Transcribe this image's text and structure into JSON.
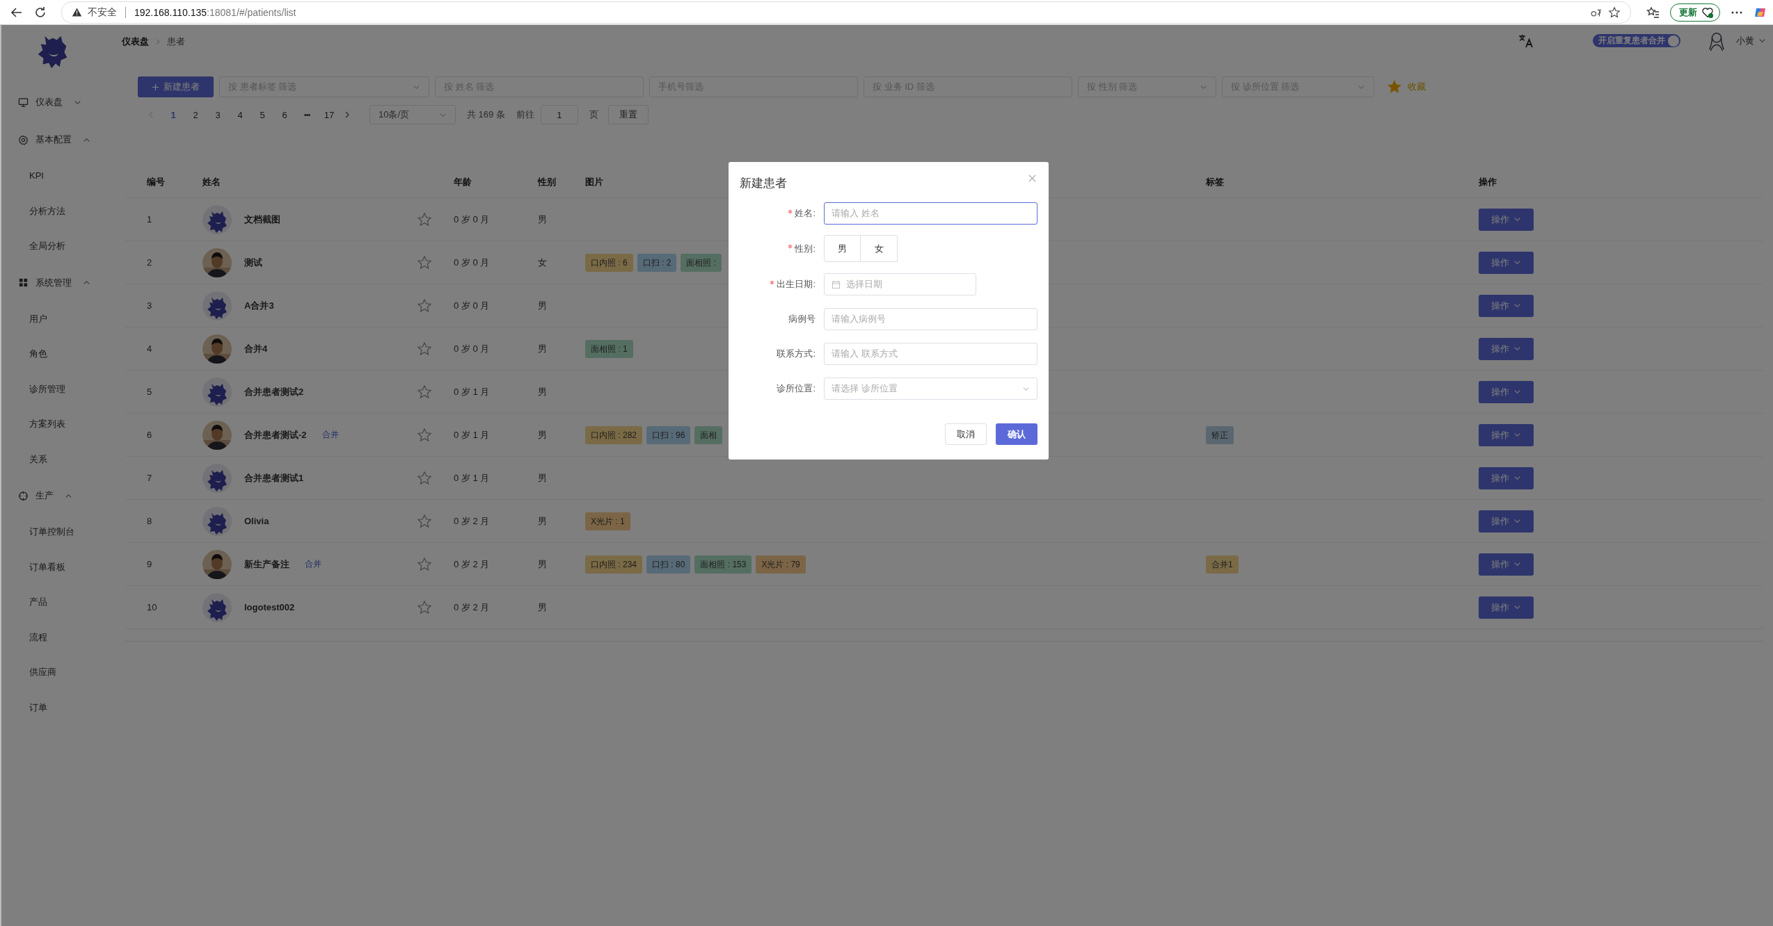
{
  "browser": {
    "security_label": "不安全",
    "url_host": "192.168.110.135",
    "url_rest": ":18081/#/patients/list",
    "update_button": "更新"
  },
  "sidebar": {
    "items": [
      {
        "label": "仪表盘",
        "expanded": false
      },
      {
        "label": "基本配置",
        "expanded": true,
        "children": [
          {
            "label": "KPI"
          },
          {
            "label": "分析方法"
          },
          {
            "label": "全局分析"
          }
        ]
      },
      {
        "label": "系统管理",
        "expanded": true,
        "children": [
          {
            "label": "用户"
          },
          {
            "label": "角色"
          },
          {
            "label": "诊所管理"
          },
          {
            "label": "方案列表"
          },
          {
            "label": "关系"
          }
        ]
      },
      {
        "label": "生产",
        "expanded": true,
        "children": [
          {
            "label": "订单控制台"
          },
          {
            "label": "订单看板"
          },
          {
            "label": "产品"
          },
          {
            "label": "流程"
          },
          {
            "label": "供应商"
          },
          {
            "label": "订单"
          }
        ]
      }
    ]
  },
  "header": {
    "breadcrumb": [
      "仪表盘",
      "患者"
    ],
    "merge_toggle": {
      "label": "开启重复患者合并",
      "on": true
    },
    "user_name": "小黄"
  },
  "toolbar": {
    "new_button": "新建患者",
    "filters": [
      {
        "kind": "select",
        "placeholder": "按 患者标签 筛选"
      },
      {
        "kind": "text",
        "placeholder": "按 姓名 筛选"
      },
      {
        "kind": "text",
        "placeholder": "手机号筛选"
      },
      {
        "kind": "text",
        "placeholder": "按 业务 ID 筛选"
      },
      {
        "kind": "select",
        "placeholder": "按 性别 筛选"
      },
      {
        "kind": "select",
        "placeholder": "按 诊所位置 筛选"
      }
    ],
    "favorites": "收藏"
  },
  "pagination": {
    "prev_disabled": true,
    "next_disabled": false,
    "pages": [
      {
        "kind": "page",
        "label": "1",
        "selected": true
      },
      {
        "kind": "page",
        "label": "2",
        "selected": false
      },
      {
        "kind": "page",
        "label": "3",
        "selected": false
      },
      {
        "kind": "page",
        "label": "4",
        "selected": false
      },
      {
        "kind": "page",
        "label": "5",
        "selected": false
      },
      {
        "kind": "page",
        "label": "6",
        "selected": false
      },
      {
        "kind": "ellipsis",
        "label": "•••",
        "selected": false
      },
      {
        "kind": "page",
        "label": "17",
        "selected": false
      }
    ],
    "page_size": "10条/页",
    "total": "共 169 条",
    "goto_label": "前往",
    "goto_value": "1",
    "goto_suffix": "页",
    "reset_button": "重置"
  },
  "table": {
    "columns": [
      "编号",
      "姓名",
      "年龄",
      "性别",
      "图片",
      "标签",
      "操作"
    ],
    "rows": [
      {
        "id": "1",
        "avatar": {
          "kind": "logo"
        },
        "name": "文档截图",
        "starred": false,
        "age": "0 岁 0 月",
        "gender": "男",
        "action": "操作"
      },
      {
        "id": "2",
        "avatar": {
          "kind": "picture"
        },
        "name": "测试",
        "starred": false,
        "age": "0 岁 0 月",
        "gender": "女",
        "images": [
          {
            "text": "口内照 : 6",
            "color": "#7a6a46"
          },
          {
            "text": "口扫 : 2",
            "color": "#576a78"
          },
          {
            "text": "面相照 :",
            "color": "#556e62"
          }
        ],
        "action": "操作"
      },
      {
        "id": "3",
        "avatar": {
          "kind": "logo"
        },
        "name": "A合并3",
        "starred": false,
        "age": "0 岁 0 月",
        "gender": "男",
        "action": "操作"
      },
      {
        "id": "4",
        "avatar": {
          "kind": "picture"
        },
        "name": "合并4",
        "starred": false,
        "age": "0 岁 0 月",
        "gender": "男",
        "images": [
          {
            "text": "面相照 : 1",
            "color": "#556e62"
          }
        ],
        "action": "操作"
      },
      {
        "id": "5",
        "avatar": {
          "kind": "logo"
        },
        "name": "合并患者测试2",
        "starred": false,
        "age": "0 岁 1 月",
        "gender": "男",
        "action": "操作"
      },
      {
        "id": "6",
        "avatar": {
          "kind": "picture"
        },
        "name": "合并患者测试-2",
        "merge_tag": "合并",
        "starred": false,
        "age": "0 岁 1 月",
        "gender": "男",
        "images": [
          {
            "text": "口内照 : 282",
            "color": "#7a6a46"
          },
          {
            "text": "口扫 : 96",
            "color": "#576a78"
          },
          {
            "text": "面相",
            "color": "#556e62"
          }
        ],
        "tags": [
          {
            "text": "矫正",
            "color": "#5a6770"
          }
        ],
        "action": "操作"
      },
      {
        "id": "7",
        "avatar": {
          "kind": "logo"
        },
        "name": "合并患者测试1",
        "starred": false,
        "age": "0 岁 1 月",
        "gender": "男",
        "action": "操作"
      },
      {
        "id": "8",
        "avatar": {
          "kind": "logo"
        },
        "name": "Olivia",
        "starred": false,
        "age": "0 岁 2 月",
        "gender": "男",
        "images": [
          {
            "text": "X光片 : 1",
            "color": "#7b6546"
          }
        ],
        "action": "操作"
      },
      {
        "id": "9",
        "avatar": {
          "kind": "picture"
        },
        "name": "新生产备注",
        "merge_tag": "合并",
        "starred": false,
        "age": "0 岁 2 月",
        "gender": "男",
        "images": [
          {
            "text": "口内照 : 234",
            "color": "#7a6a46"
          },
          {
            "text": "口扫 : 80",
            "color": "#576a78"
          },
          {
            "text": "面相照 : 153",
            "color": "#556e62"
          },
          {
            "text": "X光片 : 79",
            "color": "#7b6546"
          }
        ],
        "tags": [
          {
            "text": "合并1",
            "color": "#7a6a46"
          }
        ],
        "action": "操作"
      },
      {
        "id": "10",
        "avatar": {
          "kind": "logo"
        },
        "name": "logotest002",
        "starred": false,
        "age": "0 岁 2 月",
        "gender": "男",
        "action": "操作"
      }
    ]
  },
  "dialog": {
    "title": "新建患者",
    "fields": [
      {
        "kind": "text",
        "label": "姓名:",
        "required": true,
        "placeholder": "请输入 姓名",
        "focused": true
      },
      {
        "kind": "segmented",
        "label": "性别:",
        "required": true,
        "options": [
          {
            "label": "男",
            "selected": false
          },
          {
            "label": "女",
            "selected": false
          }
        ]
      },
      {
        "kind": "date",
        "label": "出生日期:",
        "required": true,
        "placeholder": "选择日期"
      },
      {
        "kind": "text",
        "label": "病例号",
        "required": false,
        "placeholder": "请输入病例号",
        "focused": false
      },
      {
        "kind": "text",
        "label": "联系方式:",
        "required": false,
        "placeholder": "请输入 联系方式",
        "focused": false
      },
      {
        "kind": "select",
        "label": "诊所位置:",
        "required": false,
        "placeholder": "请选择 诊所位置"
      }
    ],
    "cancel_button": "取消",
    "confirm_button": "确认"
  }
}
